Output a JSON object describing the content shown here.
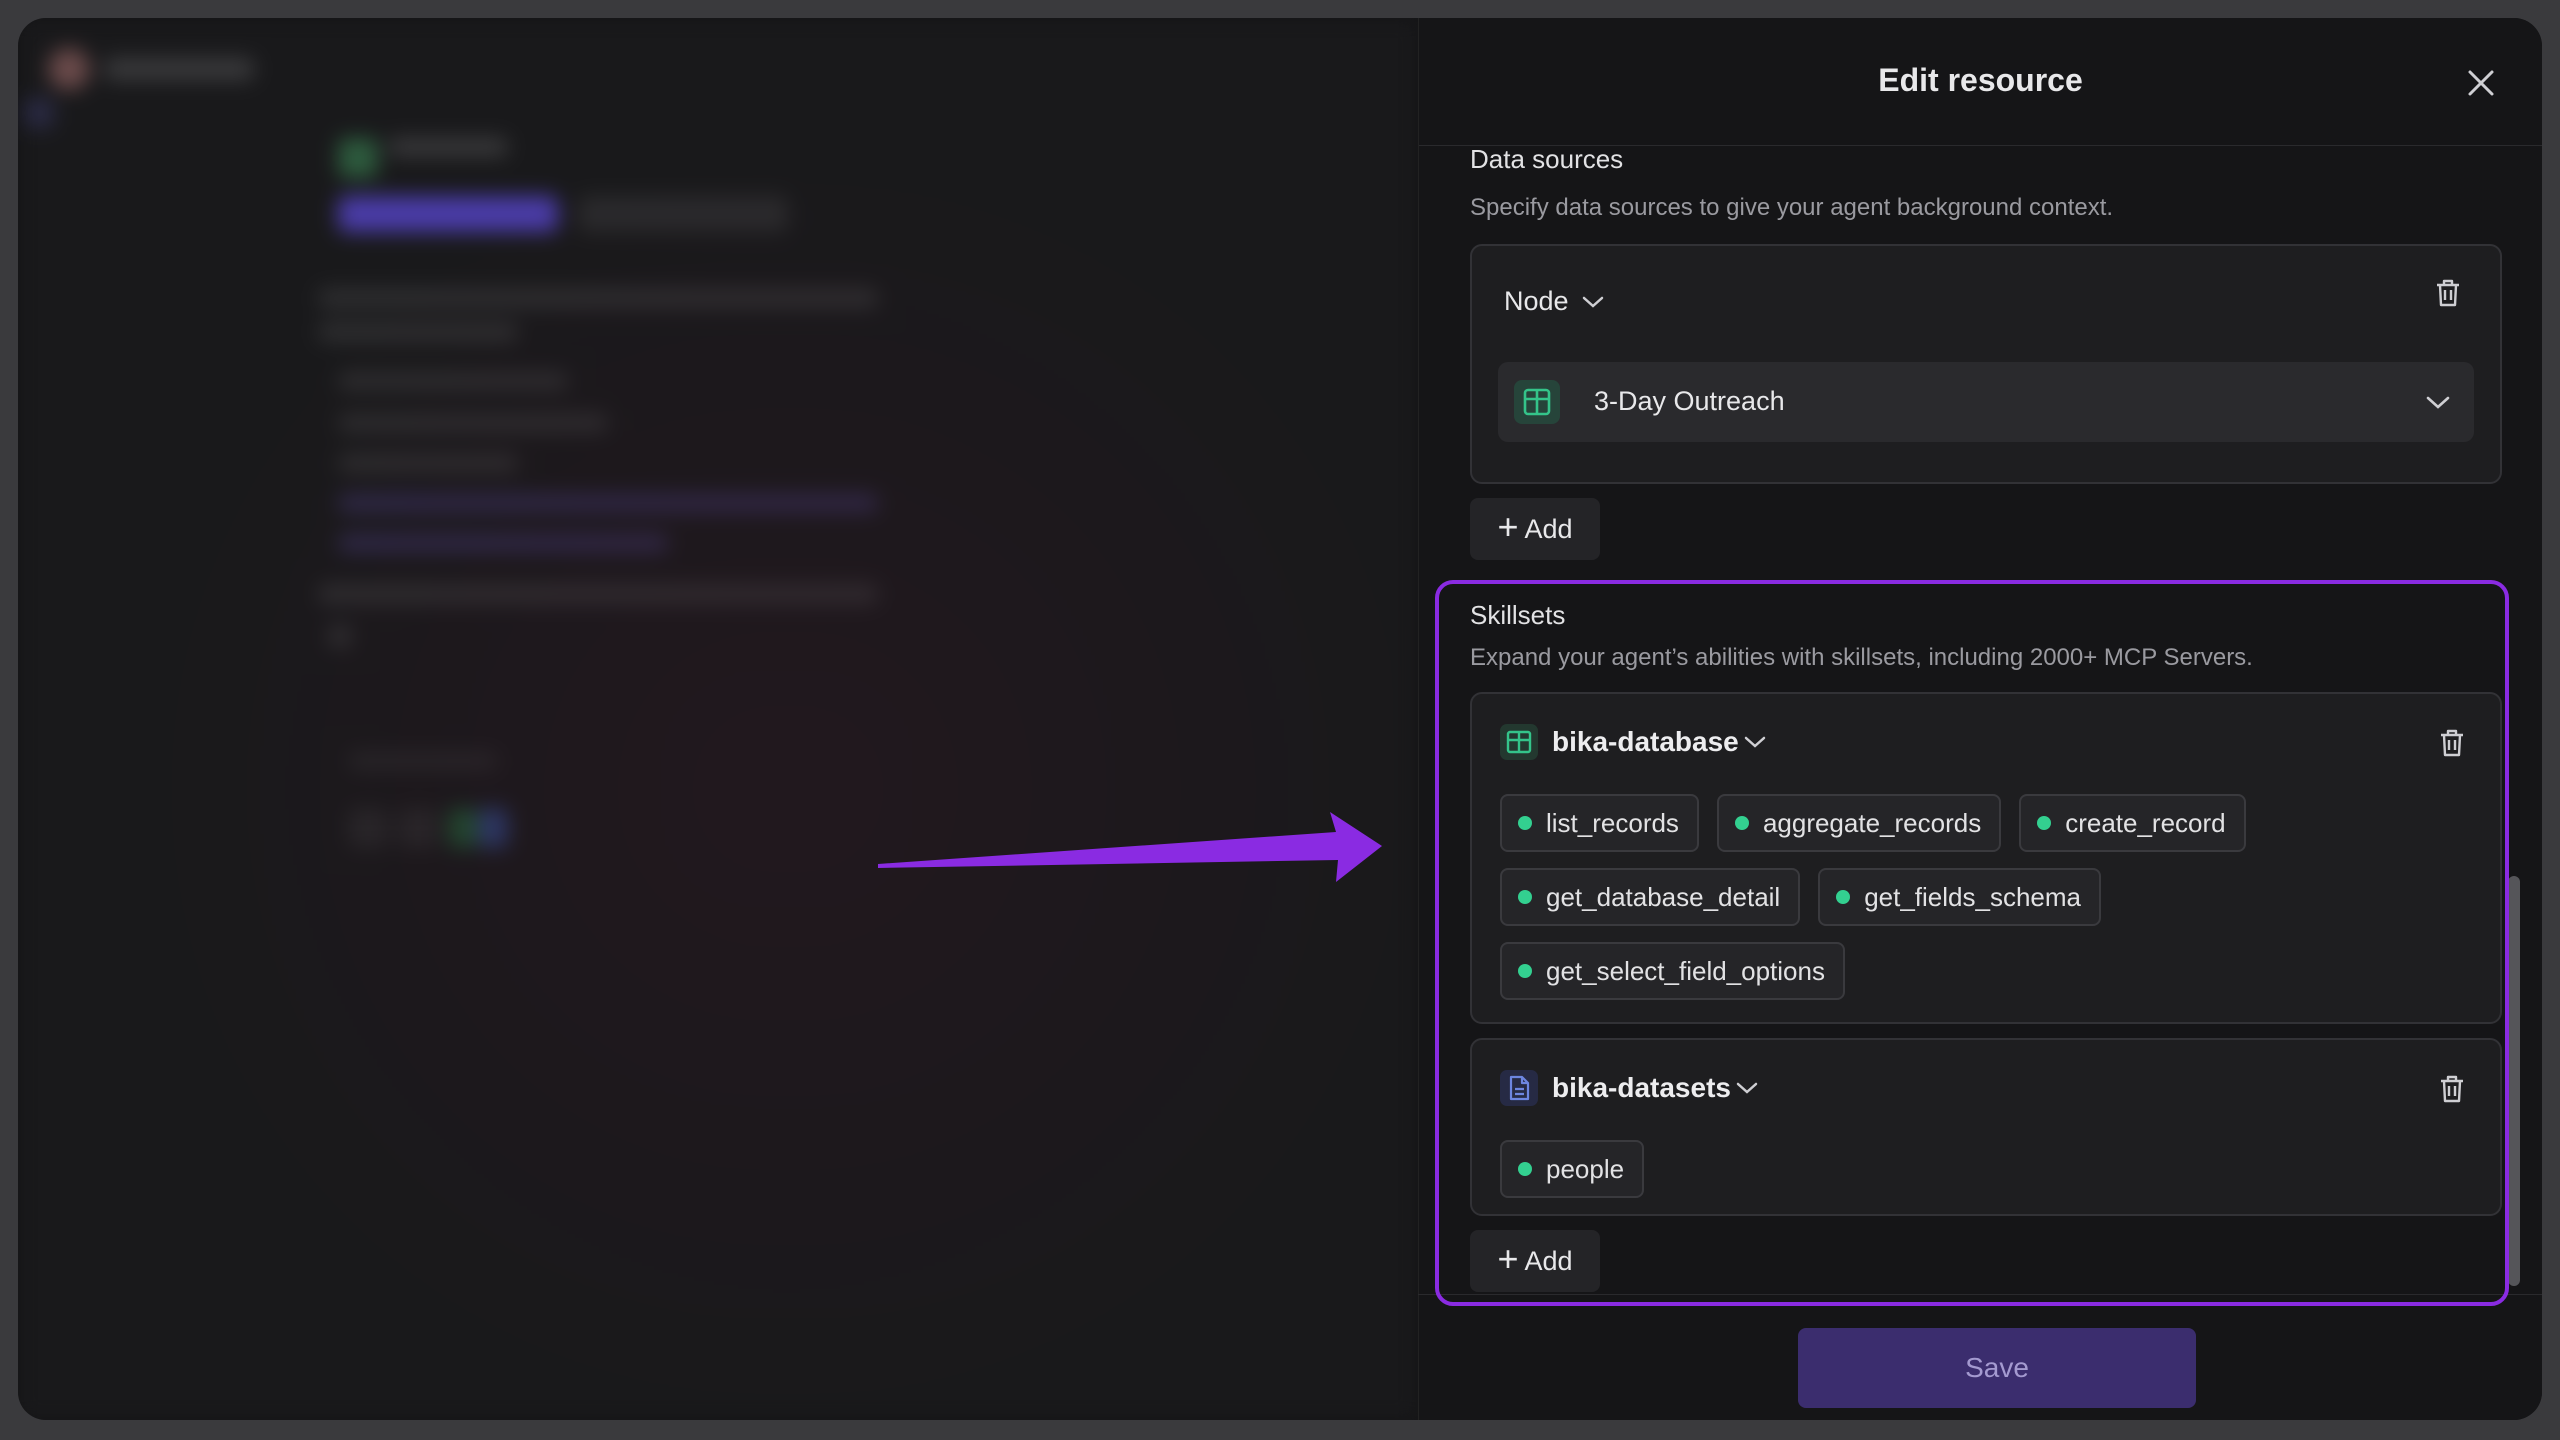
{
  "drawer": {
    "title": "Edit resource",
    "data_sources": {
      "title": "Data sources",
      "description": "Specify data sources to give your agent background context.",
      "type_label": "Node",
      "resource_label": "3-Day Outreach",
      "add_label": "Add"
    },
    "skillsets": {
      "title": "Skillsets",
      "description": "Expand your agent’s abilities with skillsets, including 2000+ MCP Servers.",
      "items": [
        {
          "name": "bika-database",
          "icon": "table-icon",
          "tools": [
            "list_records",
            "aggregate_records",
            "create_record",
            "get_database_detail",
            "get_fields_schema",
            "get_select_field_options"
          ]
        },
        {
          "name": "bika-datasets",
          "icon": "document-icon",
          "tools": [
            "people"
          ]
        }
      ],
      "add_label": "Add"
    },
    "save_label": "Save"
  },
  "colors": {
    "accent_highlight": "#8a2be2",
    "status_dot": "#33d090",
    "save_button": "#3b2d6e"
  }
}
